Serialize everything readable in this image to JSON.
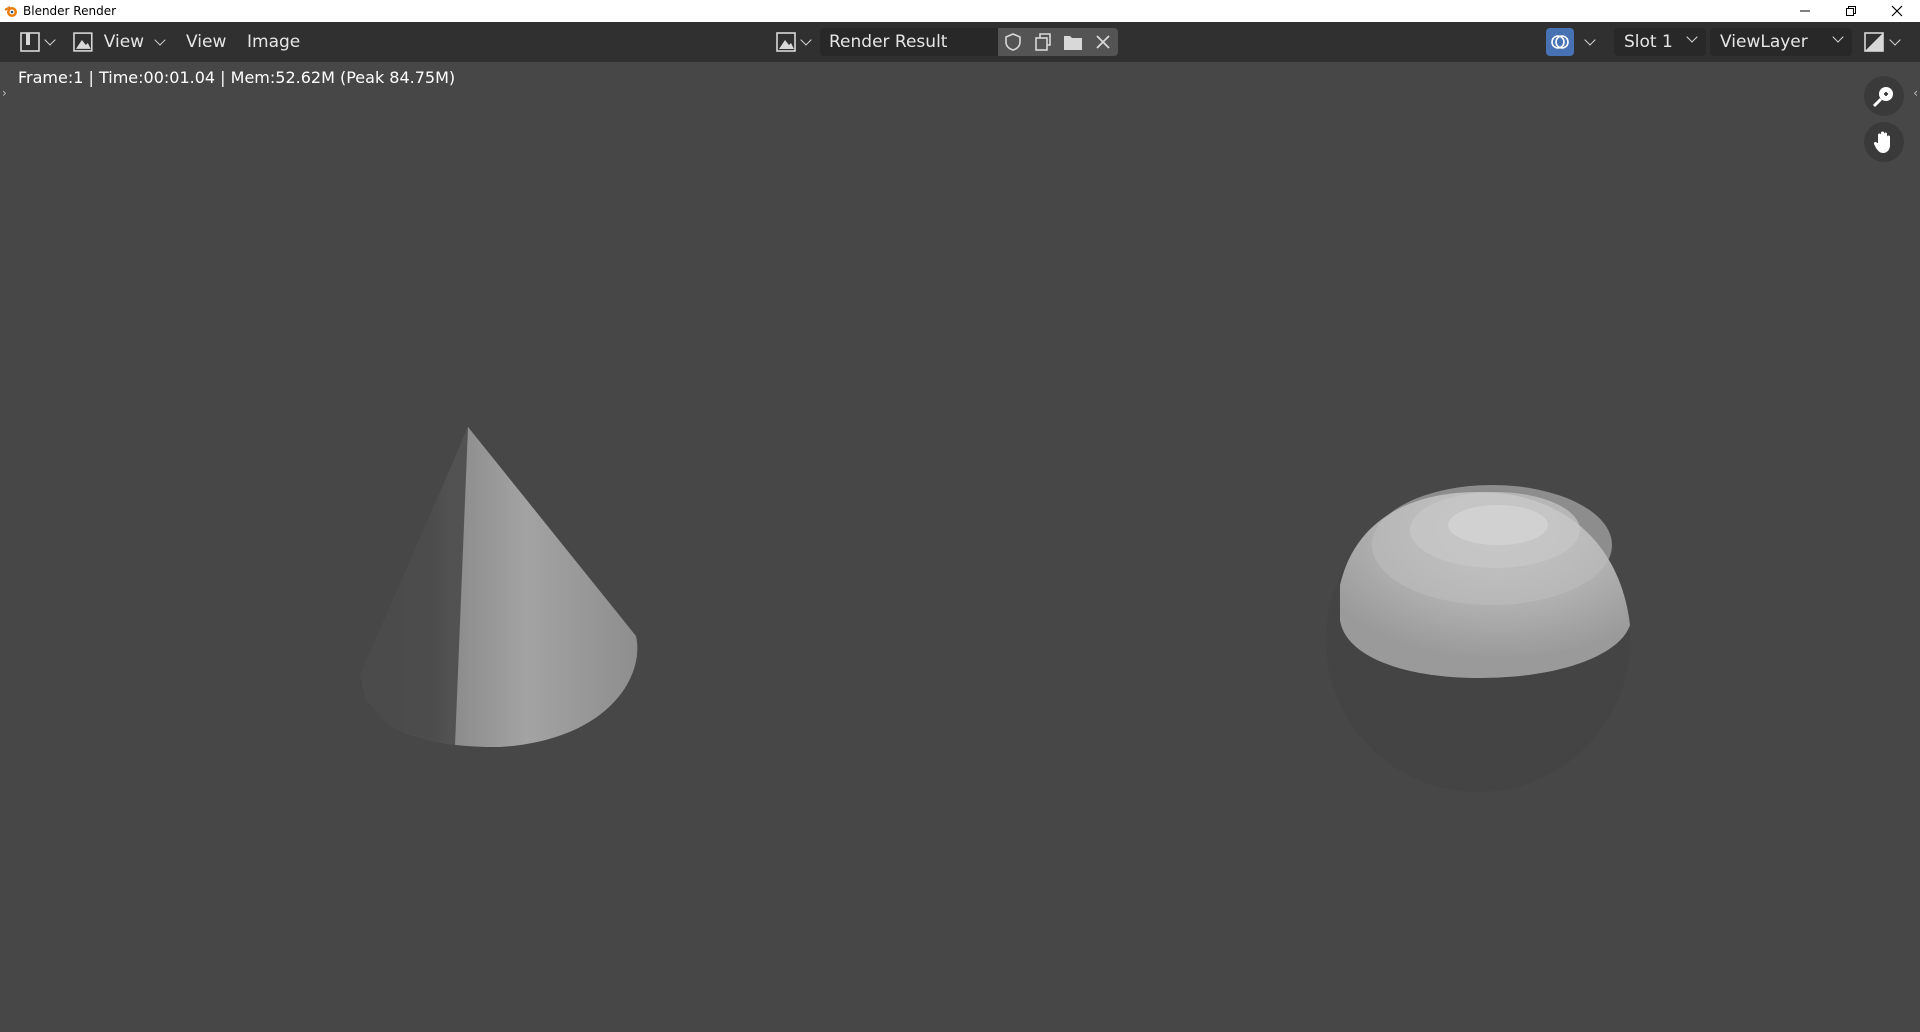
{
  "window": {
    "title": "Blender Render"
  },
  "header": {
    "view_label": "View",
    "menu_view": "View",
    "menu_image": "Image",
    "image_name": "Render Result",
    "slot": "Slot 1",
    "view_layer": "ViewLayer"
  },
  "viewport": {
    "info_text": "Frame:1 | Time:00:01.04 | Mem:52.62M (Peak 84.75M)",
    "objects": [
      "cone",
      "sphere"
    ]
  },
  "colors": {
    "background": "#474747",
    "header": "#303030",
    "field": "#282828",
    "accent": "#4772b3"
  }
}
